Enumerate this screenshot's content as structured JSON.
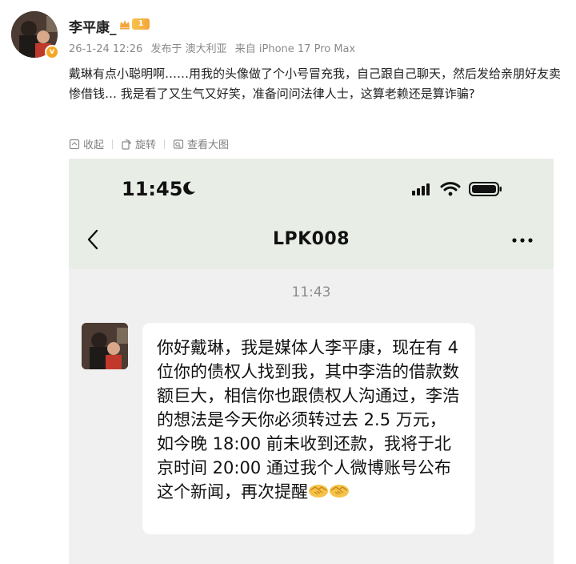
{
  "post": {
    "username": "李平康_",
    "level": "1",
    "verify_mark": "v",
    "meta": {
      "datetime": "26-1-24 12:26",
      "location": "发布于 澳大利亚",
      "device": "来自 iPhone 17 Pro Max"
    },
    "text": "戴琳有点小聪明啊……用我的头像做了个小号冒充我，自己跟自己聊天，然后发给亲朋好友卖惨借钱… 我是看了又生气又好笑，准备问问法律人士，这算老赖还是算诈骗?",
    "actions": {
      "favorite": "收起",
      "repost": "旋转",
      "view_large": "查看大图"
    }
  },
  "screenshot": {
    "status_time": "11:45",
    "chat_title": "LPK008",
    "timestamp": "11:43",
    "message": "你好戴琳，我是媒体人李平康，现在有 4 位你的债权人找到我，其中李浩的借款数额巨大，相信你也跟债权人沟通过，李浩的想法是今天你必须转过去 2.5 万元，如今晚 18:00 前未收到还款，我将于北京时间 20:00 通过我个人微博账号公布这个新闻，再次提醒",
    "emoji": "handshake-icon x2"
  },
  "colors": {
    "accent_orange": "#f5a623",
    "chat_bg": "#f0f0f0",
    "chat_header_bg": "#e8eee6",
    "meta_gray": "#8a8a8a"
  }
}
